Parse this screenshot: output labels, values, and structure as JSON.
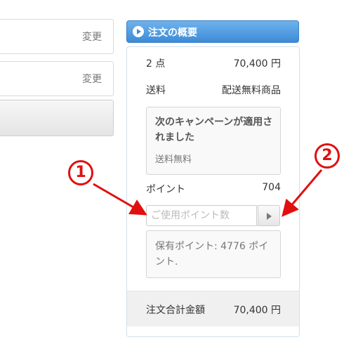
{
  "left": {
    "address_change_label": "変更",
    "payment_change_label": "変更"
  },
  "summary": {
    "header_title": "注文の概要",
    "items_count": "2 点",
    "items_price": "70,400 円",
    "shipping_label": "送料",
    "shipping_value": "配送無料商品",
    "campaign_title": "次のキャンペーンが適用されました",
    "campaign_detail": "送料無料",
    "points_label": "ポイント",
    "points_value": "704",
    "point_input_placeholder": "ご使用ポイント数",
    "held_points_text": "保有ポイント: 4776 ポイント.",
    "total_label": "注文合計金額",
    "total_value": "70,400 円"
  },
  "annotations": {
    "marker_1": "1",
    "marker_2": "2",
    "color": "#e01010"
  },
  "colors": {
    "header_blue": "#3d8ad6",
    "annotation_red": "#e01010"
  }
}
